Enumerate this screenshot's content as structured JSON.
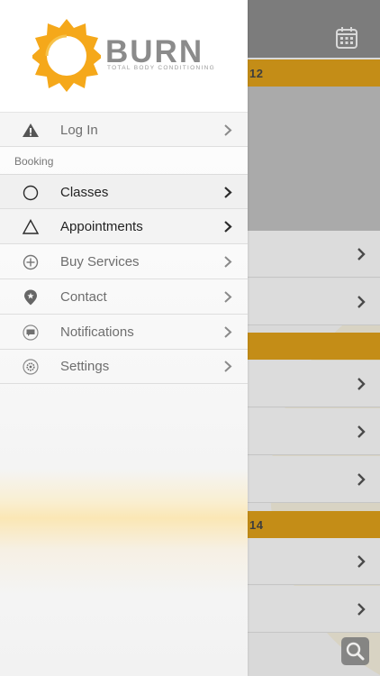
{
  "background": {
    "bands": [
      {
        "text": "12"
      },
      {
        "text": ""
      },
      {
        "text": "14"
      }
    ]
  },
  "drawer": {
    "logo": {
      "word": "BURN",
      "tagline": "TOTAL BODY CONDITIONING"
    },
    "section_label": "Booking",
    "items": [
      {
        "label": "Log In",
        "icon": "warning-icon"
      },
      {
        "label": "Classes",
        "icon": "circle-icon"
      },
      {
        "label": "Appointments",
        "icon": "triangle-icon"
      },
      {
        "label": "Buy Services",
        "icon": "plus-circle-icon"
      },
      {
        "label": "Contact",
        "icon": "location-pin-icon"
      },
      {
        "label": "Notifications",
        "icon": "speech-bubble-icon"
      },
      {
        "label": "Settings",
        "icon": "gear-icon"
      }
    ]
  },
  "colors": {
    "accent": "#c48d17",
    "logo_orange": "#f5a81a"
  }
}
